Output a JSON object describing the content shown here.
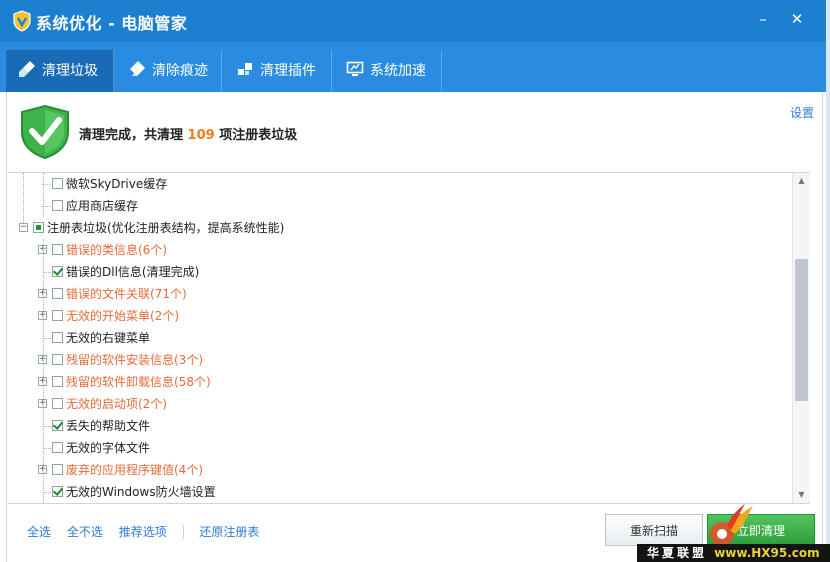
{
  "window": {
    "title": "系统优化 - 电脑管家",
    "minimize_glyph": "–",
    "close_glyph": "✕"
  },
  "tabs": [
    {
      "label": "清理垃圾",
      "icon": "broom-icon",
      "active": true
    },
    {
      "label": "清除痕迹",
      "icon": "eraser-icon",
      "active": false
    },
    {
      "label": "清理插件",
      "icon": "plugin-icon",
      "active": false
    },
    {
      "label": "系统加速",
      "icon": "monitor-icon",
      "active": false
    }
  ],
  "settings_label": "设置",
  "status": {
    "prefix": "清理完成，共清理 ",
    "count": "109",
    "suffix": " 项注册表垃圾",
    "icon": "green-check-shield-icon"
  },
  "tree": {
    "rows": [
      {
        "label": "微软SkyDrive缓存",
        "state": "unchecked",
        "color": "normal",
        "level": 2,
        "expander": false
      },
      {
        "label": "应用商店缓存",
        "state": "unchecked",
        "color": "normal",
        "level": 2,
        "expander": false
      },
      {
        "label": "注册表垃圾(优化注册表结构，提高系统性能)",
        "state": "partial",
        "color": "normal",
        "level": 0,
        "expander": "minus"
      },
      {
        "label": "错误的类信息(6个)",
        "state": "unchecked",
        "color": "red",
        "level": 1,
        "expander": "plus"
      },
      {
        "label": "错误的Dll信息(清理完成)",
        "state": "checked",
        "color": "normal",
        "level": 1,
        "expander": false
      },
      {
        "label": "错误的文件关联(71个)",
        "state": "unchecked",
        "color": "red",
        "level": 1,
        "expander": "plus"
      },
      {
        "label": "无效的开始菜单(2个)",
        "state": "unchecked",
        "color": "red",
        "level": 1,
        "expander": "plus"
      },
      {
        "label": "无效的右键菜单",
        "state": "unchecked",
        "color": "normal",
        "level": 1,
        "expander": false
      },
      {
        "label": "残留的软件安装信息(3个)",
        "state": "unchecked",
        "color": "red",
        "level": 1,
        "expander": "plus"
      },
      {
        "label": "残留的软件卸载信息(58个)",
        "state": "unchecked",
        "color": "red",
        "level": 1,
        "expander": "plus"
      },
      {
        "label": "无效的启动项(2个)",
        "state": "unchecked",
        "color": "red",
        "level": 1,
        "expander": "plus"
      },
      {
        "label": "丢失的帮助文件",
        "state": "checked",
        "color": "normal",
        "level": 1,
        "expander": false
      },
      {
        "label": "无效的字体文件",
        "state": "unchecked",
        "color": "normal",
        "level": 1,
        "expander": false
      },
      {
        "label": "废弃的应用程序键值(4个)",
        "state": "unchecked",
        "color": "red",
        "level": 1,
        "expander": "plus"
      },
      {
        "label": "无效的Windows防火墙设置",
        "state": "checked",
        "color": "normal",
        "level": 1,
        "expander": false
      }
    ]
  },
  "scrollbar": {
    "position_fraction": 0.45
  },
  "footer": {
    "links": [
      "全选",
      "全不选",
      "推荐选项"
    ],
    "restore": "还原注册表",
    "rescan": "重新扫描",
    "clean_now": "立即清理"
  },
  "watermark": {
    "text": "华夏联盟",
    "site": "www.HX95.com"
  },
  "colors": {
    "titlebar": "#1d7fd0",
    "tabbar": "#2a8ce0",
    "active_tab": "#196bb5",
    "link": "#2d7ad6",
    "highlight": "#f07c18",
    "error_item": "#e56b3a"
  }
}
